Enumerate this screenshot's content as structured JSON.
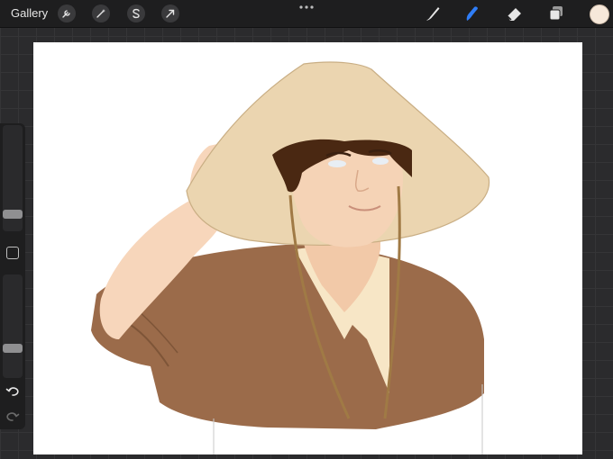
{
  "topbar": {
    "gallery_label": "Gallery",
    "tools": [
      {
        "icon": "wrench-icon"
      },
      {
        "icon": "magic-wand-icon"
      },
      {
        "icon": "selection-s-icon"
      },
      {
        "icon": "arrow-transform-icon"
      }
    ],
    "more_icon": "ellipsis-icon",
    "right_tools": [
      {
        "icon": "brush-icon"
      },
      {
        "icon": "smudge-icon",
        "active": true
      },
      {
        "icon": "eraser-icon"
      },
      {
        "icon": "layers-icon"
      }
    ],
    "current_color": "#f6e8da"
  },
  "sidebar": {
    "brush_size_level": 0.3,
    "opacity_level": 0.27,
    "icons": [
      "modify-square-icon",
      "undo-icon",
      "redo-icon"
    ]
  },
  "colors": {
    "accent": "#2f7df6",
    "hat": "#ebd5b0",
    "shirt": "#9b6b4a",
    "skin": "#f5d3b6",
    "hair": "#4a2812"
  }
}
